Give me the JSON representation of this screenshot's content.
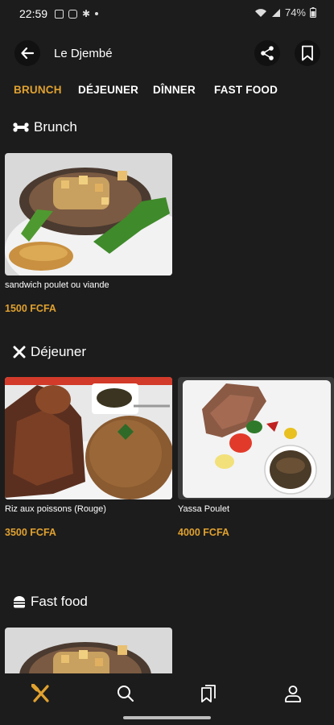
{
  "status_bar": {
    "time": "22:59",
    "battery": "74%"
  },
  "app_bar": {
    "title": "Le Djembé"
  },
  "tabs": [
    {
      "label": "BRUNCH",
      "active": true
    },
    {
      "label": "DÉJEUNER",
      "active": false
    },
    {
      "label": "DÎNNER",
      "active": false
    },
    {
      "label": "FAST FOOD",
      "active": false
    }
  ],
  "sections": {
    "brunch": {
      "title": "Brunch",
      "icon": "bone-icon",
      "items": [
        {
          "name": "sandwich  poulet ou viande",
          "price": "1500 FCFA"
        }
      ]
    },
    "dejeuner": {
      "title": "Déjeuner",
      "icon": "utensils-crossed-icon",
      "items": [
        {
          "name": "Riz aux poissons (Rouge)",
          "price": "3500 FCFA"
        },
        {
          "name": "Yassa Poulet",
          "price": "4000 FCFA"
        }
      ]
    },
    "fast_food": {
      "title": "Fast food",
      "icon": "burger-icon",
      "items": []
    }
  },
  "bottom_nav": [
    {
      "icon": "utensils-icon",
      "active": true
    },
    {
      "icon": "search-icon",
      "active": false
    },
    {
      "icon": "bookmarks-icon",
      "active": false
    },
    {
      "icon": "user-icon",
      "active": false
    }
  ],
  "colors": {
    "background": "#1c1c1c",
    "accent": "#e0a12f",
    "text": "#ffffff"
  }
}
